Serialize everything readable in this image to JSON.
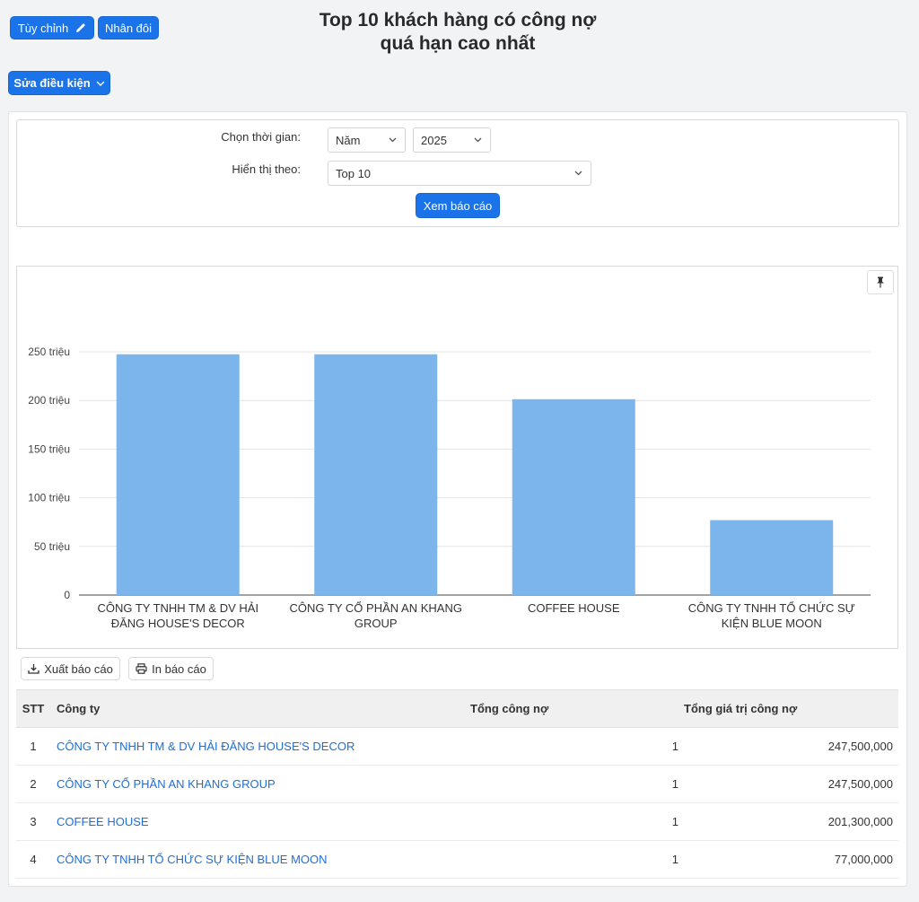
{
  "toolbar": {
    "customize_label": "Tùy chỉnh",
    "duplicate_label": "Nhân đôi",
    "edit_condition_label": "Sửa điều kiện"
  },
  "page_title_line1": "Top 10 khách hàng có công nợ",
  "page_title_line2": "quá hạn cao nhất",
  "filters": {
    "time_label": "Chọn thời gian:",
    "period_value": "Năm",
    "year_value": "2025",
    "display_label": "Hiển thị theo:",
    "top_value": "Top 10",
    "view_button": "Xem báo cáo"
  },
  "chart_data": {
    "type": "bar",
    "categories": [
      [
        "CÔNG TY TNHH TM & DV HẢI",
        "ĐĂNG HOUSE'S DECOR"
      ],
      [
        "CÔNG TY CỔ PHẦN AN KHANG",
        "GROUP"
      ],
      [
        "COFFEE HOUSE"
      ],
      [
        "CÔNG TY TNHH TỔ CHỨC SỰ",
        "KIỆN BLUE MOON"
      ]
    ],
    "values": [
      247500000,
      247500000,
      201300000,
      77000000
    ],
    "ylim": [
      0,
      250000000
    ],
    "ytick_values": [
      0,
      50000000,
      100000000,
      150000000,
      200000000,
      250000000
    ],
    "yticks": [
      "0",
      "50 triệu",
      "100 triệu",
      "150 triệu",
      "200 triệu",
      "250 triệu"
    ],
    "bar_color": "#7cb5ec",
    "grid": true
  },
  "actions": {
    "export_label": "Xuất báo cáo",
    "print_label": "In báo cáo"
  },
  "table": {
    "headers": {
      "stt": "STT",
      "company": "Công ty",
      "total_debt": "Tổng công nợ",
      "total_value": "Tổng giá trị công nợ"
    },
    "rows": [
      {
        "stt": "1",
        "company": "CÔNG TY TNHH TM & DV HẢI ĐĂNG HOUSE'S DECOR",
        "count": "1",
        "value": "247,500,000"
      },
      {
        "stt": "2",
        "company": "CÔNG TY CỔ PHẦN AN KHANG GROUP",
        "count": "1",
        "value": "247,500,000"
      },
      {
        "stt": "3",
        "company": "COFFEE HOUSE",
        "count": "1",
        "value": "201,300,000"
      },
      {
        "stt": "4",
        "company": "CÔNG TY TNHH TỔ CHỨC SỰ KIỆN BLUE MOON",
        "count": "1",
        "value": "77,000,000"
      }
    ]
  }
}
